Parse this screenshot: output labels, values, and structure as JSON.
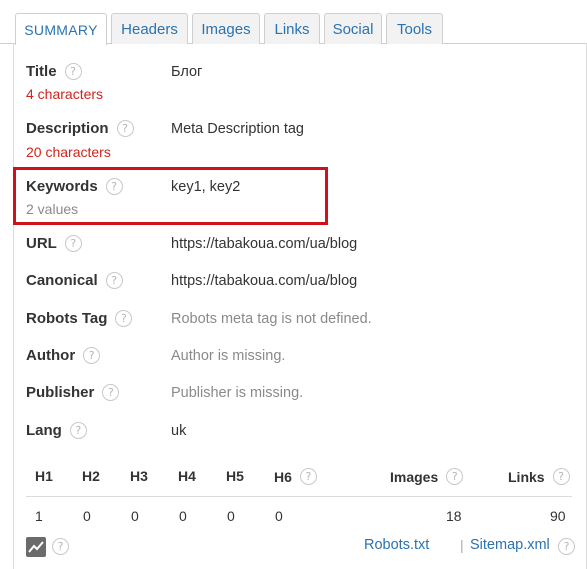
{
  "tabs": [
    "SUMMARY",
    "Headers",
    "Images",
    "Links",
    "Social",
    "Tools"
  ],
  "summary": {
    "title": {
      "label": "Title",
      "meta": "4 characters",
      "value": "Блог"
    },
    "description": {
      "label": "Description",
      "meta": "20 characters",
      "value": "Meta Description tag"
    },
    "keywords": {
      "label": "Keywords",
      "meta": "2 values",
      "value": "key1, key2"
    },
    "url": {
      "label": "URL",
      "value": "https://tabakoua.com/ua/blog"
    },
    "canonical": {
      "label": "Canonical",
      "value": "https://tabakoua.com/ua/blog"
    },
    "robots_tag": {
      "label": "Robots Tag",
      "value": "Robots meta tag is not defined."
    },
    "author": {
      "label": "Author",
      "value": "Author is missing."
    },
    "publisher": {
      "label": "Publisher",
      "value": "Publisher is missing."
    },
    "lang": {
      "label": "Lang",
      "value": "uk"
    }
  },
  "headings": {
    "columns": [
      "H1",
      "H2",
      "H3",
      "H4",
      "H5",
      "H6",
      "Images",
      "Links"
    ],
    "values": [
      "1",
      "0",
      "0",
      "0",
      "0",
      "0",
      "18",
      "90"
    ]
  },
  "help_glyph": "?",
  "footer": {
    "robots": "Robots.txt",
    "sitemap": "Sitemap.xml",
    "separator": "|"
  },
  "colors": {
    "link": "#2a73b0",
    "warning": "#d0241c",
    "highlight": "#d0101a"
  }
}
